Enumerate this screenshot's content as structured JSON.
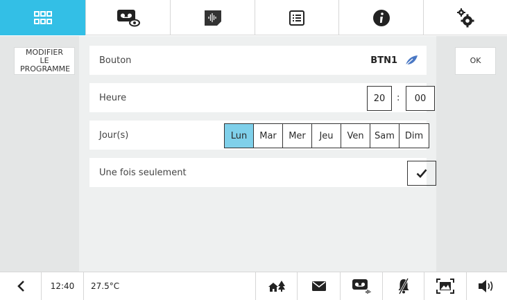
{
  "left": {
    "modify_label": "MODIFIER LE PROGRAMME"
  },
  "right": {
    "ok_label": "OK"
  },
  "rows": {
    "button": {
      "label": "Bouton",
      "value": "BTN1"
    },
    "time": {
      "label": "Heure",
      "hour": "20",
      "separator": ":",
      "minute": "00"
    },
    "days": {
      "label": "Jour(s)",
      "items": [
        "Lun",
        "Mar",
        "Mer",
        "Jeu",
        "Ven",
        "Sam",
        "Dim"
      ],
      "selected": "Lun"
    },
    "once": {
      "label": "Une fois seulement",
      "checked": true
    }
  },
  "bottom": {
    "time": "12:40",
    "temperature": "27.5°C"
  },
  "colors": {
    "accent": "#33bfe6",
    "selected_day": "#7fd0ea",
    "leaf": "#4a78c4"
  },
  "icons": {
    "top_tabs": [
      "apps-grid-icon",
      "video-message-icon",
      "audio-memo-icon",
      "list-icon",
      "info-icon",
      "settings-gears-icon"
    ],
    "bottom": [
      "back-chevron-icon",
      "home-tree-icon",
      "mail-icon",
      "voicemail-icon",
      "mute-bell-icon",
      "picture-icon",
      "volume-icon"
    ]
  }
}
